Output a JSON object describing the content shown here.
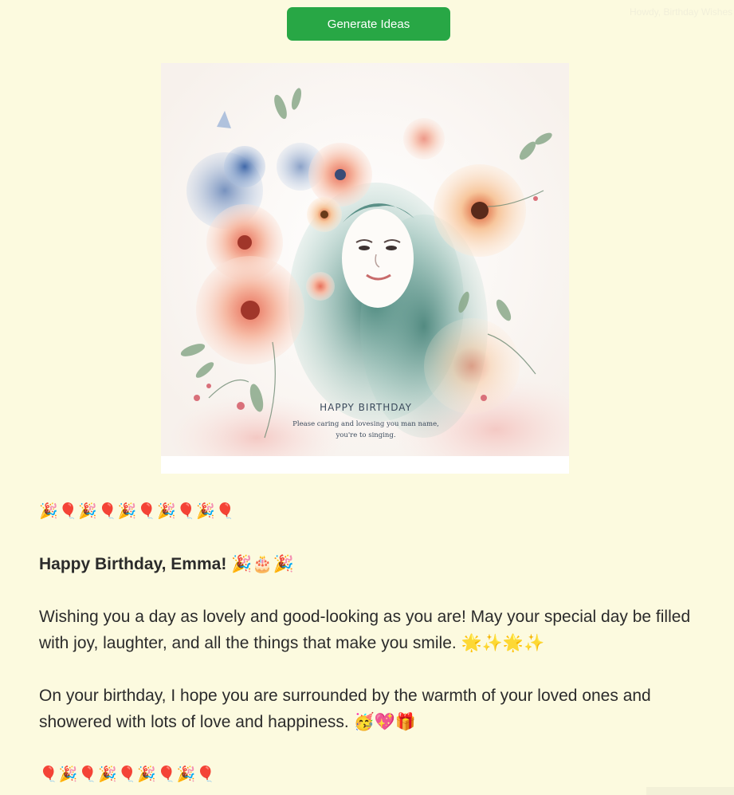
{
  "header": {
    "ghost_text": "Howdy, Birthday Wishes",
    "generate_button_label": "Generate Ideas"
  },
  "card": {
    "title": "HAPPY BIRTHDAY",
    "subtitle_line1": "Please caring and lovesing you man name,",
    "subtitle_line2": "you're to singing."
  },
  "message": {
    "emoji_row_top": "🎉🎈🎉🎈🎉🎈🎉🎈🎉🎈",
    "greeting": "Happy Birthday, Emma! 🎉🎂🎉",
    "paragraph1": "Wishing you a day as lovely and good-looking as you are! May your special day be filled with joy, laughter, and all the things that make you smile. 🌟✨🌟✨",
    "paragraph2": "On your birthday, I hope you are surrounded by the warmth of your loved ones and showered with lots of love and happiness. 🥳💖🎁",
    "emoji_row_bottom": "🎈🎉🎈🎉🎈🎉🎈🎉🎈"
  },
  "colors": {
    "background": "#fcfadf",
    "button": "#28a745",
    "button_text": "#ffffff",
    "text": "#2b2b2b"
  }
}
